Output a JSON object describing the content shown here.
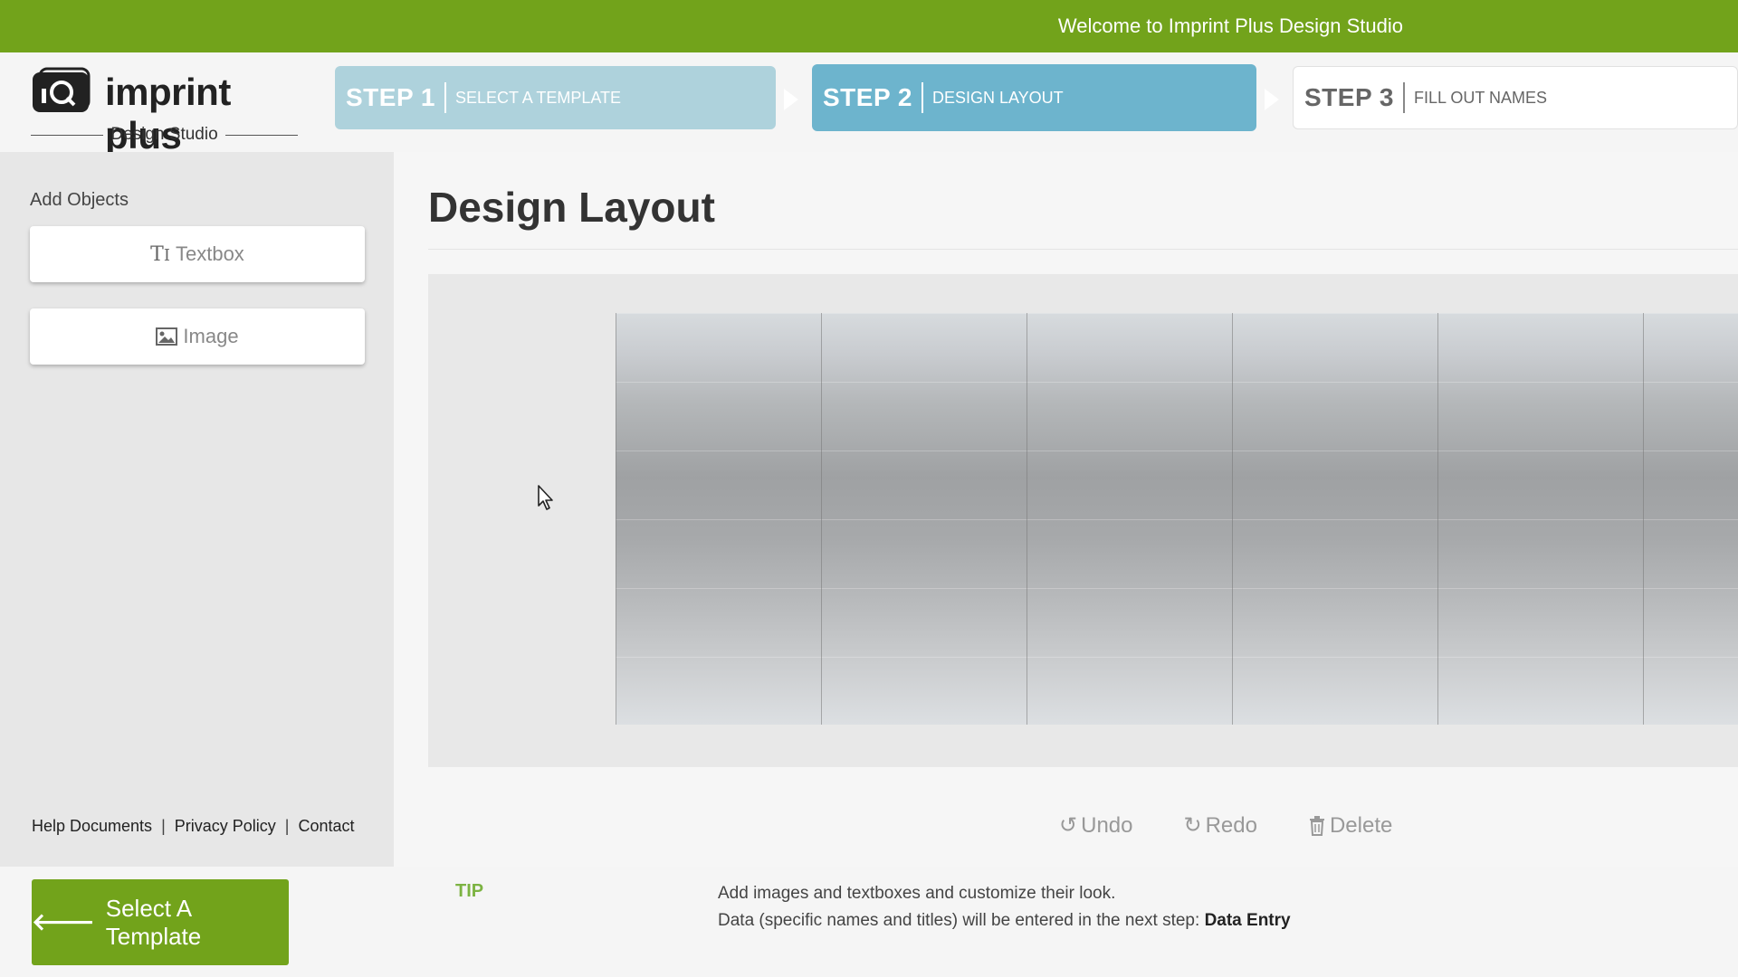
{
  "banner": {
    "text": "Welcome to Imprint Plus Design Studio"
  },
  "logo": {
    "brand": "imprint plus",
    "subtitle": "Design Studio"
  },
  "steps": [
    {
      "number": "STEP 1",
      "label": "SELECT A TEMPLATE",
      "state": "completed"
    },
    {
      "number": "STEP 2",
      "label": "DESIGN LAYOUT",
      "state": "active"
    },
    {
      "number": "STEP 3",
      "label": "FILL OUT NAMES",
      "state": "upcoming"
    }
  ],
  "sidebar": {
    "title": "Add Objects",
    "buttons": [
      {
        "label": "Textbox",
        "icon": "text-icon"
      },
      {
        "label": "Image",
        "icon": "image-icon"
      }
    ],
    "footer_links": [
      "Help Documents",
      "Privacy Policy",
      "Contact"
    ]
  },
  "main": {
    "title": "Design Layout"
  },
  "toolbar": {
    "undo": "Undo",
    "redo": "Redo",
    "delete": "Delete"
  },
  "bottom": {
    "back_label": "Select A Template",
    "tip_label": "TIP",
    "tip_line1": "Add images and textboxes and customize their look.",
    "tip_line2": "Data (specific names and titles) will be entered in the next step:",
    "tip_line2_bold": "Data Entry"
  },
  "colors": {
    "brand_green": "#72a31b",
    "step_active": "#6db4cd",
    "step_done": "#aed2dc",
    "tip_green": "#7cb342"
  }
}
